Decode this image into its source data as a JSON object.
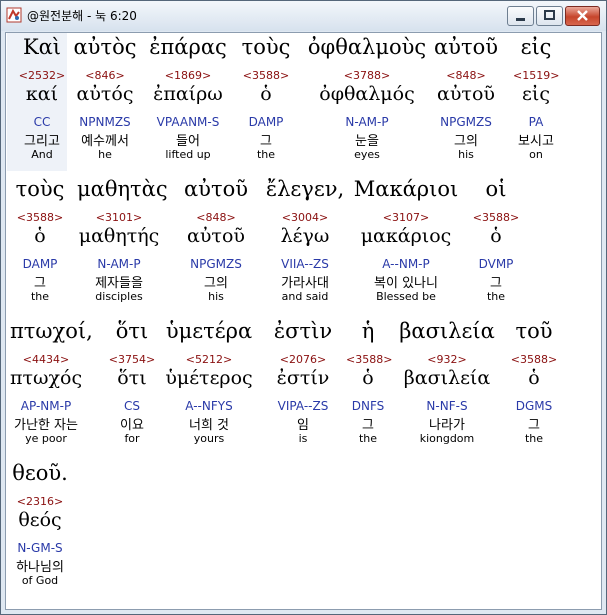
{
  "window": {
    "title": "@원전분해 - 눅 6:20"
  },
  "verses": [
    {
      "greek": "Καὶ",
      "strong": "<2532>",
      "lemma": "καί",
      "parsing": "CC",
      "korean": "그리고",
      "english": "And"
    },
    {
      "greek": "αὐτὸς",
      "strong": "<846>",
      "lemma": "αὐτός",
      "parsing": "NPNMZS",
      "korean": "예수께서",
      "english": "he"
    },
    {
      "greek": "ἐπάρας",
      "strong": "<1869>",
      "lemma": "ἐπαίρω",
      "parsing": "VPAANM-S",
      "korean": "들어",
      "english": "lifted up"
    },
    {
      "greek": "τοὺς",
      "strong": "<3588>",
      "lemma": "ὁ",
      "parsing": "DAMP",
      "korean": "그",
      "english": "the"
    },
    {
      "greek": "ὀφθαλμοὺς",
      "strong": "<3788>",
      "lemma": "ὀφθαλμός",
      "parsing": "N-AM-P",
      "korean": "눈을",
      "english": "eyes"
    },
    {
      "greek": "αὐτοῦ",
      "strong": "<848>",
      "lemma": "αὐτοῦ",
      "parsing": "NPGMZS",
      "korean": "그의",
      "english": "his"
    },
    {
      "greek": "εἰς",
      "strong": "<1519>",
      "lemma": "εἰς",
      "parsing": "PA",
      "korean": "보시고",
      "english": "on"
    },
    {
      "greek": "τοὺς",
      "strong": "<3588>",
      "lemma": "ὁ",
      "parsing": "DAMP",
      "korean": "그",
      "english": "the"
    },
    {
      "greek": "μαθητὰς",
      "strong": "<3101>",
      "lemma": "μαθητής",
      "parsing": "N-AM-P",
      "korean": "제자들을",
      "english": "disciples"
    },
    {
      "greek": "αὐτοῦ",
      "strong": "<848>",
      "lemma": "αὐτοῦ",
      "parsing": "NPGMZS",
      "korean": "그의",
      "english": "his"
    },
    {
      "greek": "ἔλεγεν,",
      "strong": "<3004>",
      "lemma": "λέγω",
      "parsing": "VIIA--ZS",
      "korean": "가라사대",
      "english": "and said"
    },
    {
      "greek": "Μακάριοι",
      "strong": "<3107>",
      "lemma": "μακάριος",
      "parsing": "A--NM-P",
      "korean": "복이 있나니",
      "english": "Blessed be"
    },
    {
      "greek": "οἱ",
      "strong": "<3588>",
      "lemma": "ὁ",
      "parsing": "DVMP",
      "korean": "그",
      "english": "the"
    },
    {
      "greek": "πτωχοί,",
      "strong": "<4434>",
      "lemma": "πτωχός",
      "parsing": "AP-NM-P",
      "korean": "가난한 자는",
      "english": "ye poor"
    },
    {
      "greek": "ὅτι",
      "strong": "<3754>",
      "lemma": "ὅτι",
      "parsing": "CS",
      "korean": "이요",
      "english": "for"
    },
    {
      "greek": "ὑμετέρα",
      "strong": "<5212>",
      "lemma": "ὑμέτερος",
      "parsing": "A--NFYS",
      "korean": "너희 것",
      "english": "yours"
    },
    {
      "greek": "ἐστὶν",
      "strong": "<2076>",
      "lemma": "ἐστίν",
      "parsing": "VIPA--ZS",
      "korean": "임",
      "english": "is"
    },
    {
      "greek": "ἡ",
      "strong": "<3588>",
      "lemma": "ὁ",
      "parsing": "DNFS",
      "korean": "그",
      "english": "the"
    },
    {
      "greek": "βασιλεία",
      "strong": "<932>",
      "lemma": "βασιλεία",
      "parsing": "N-NF-S",
      "korean": "나라가",
      "english": "kiongdom"
    },
    {
      "greek": "τοῦ",
      "strong": "<3588>",
      "lemma": "ὁ",
      "parsing": "DGMS",
      "korean": "그",
      "english": "the"
    },
    {
      "greek": "θεοῦ.",
      "strong": "<2316>",
      "lemma": "θεός",
      "parsing": "N-GM-S",
      "korean": "하나님의",
      "english": "of God"
    }
  ]
}
